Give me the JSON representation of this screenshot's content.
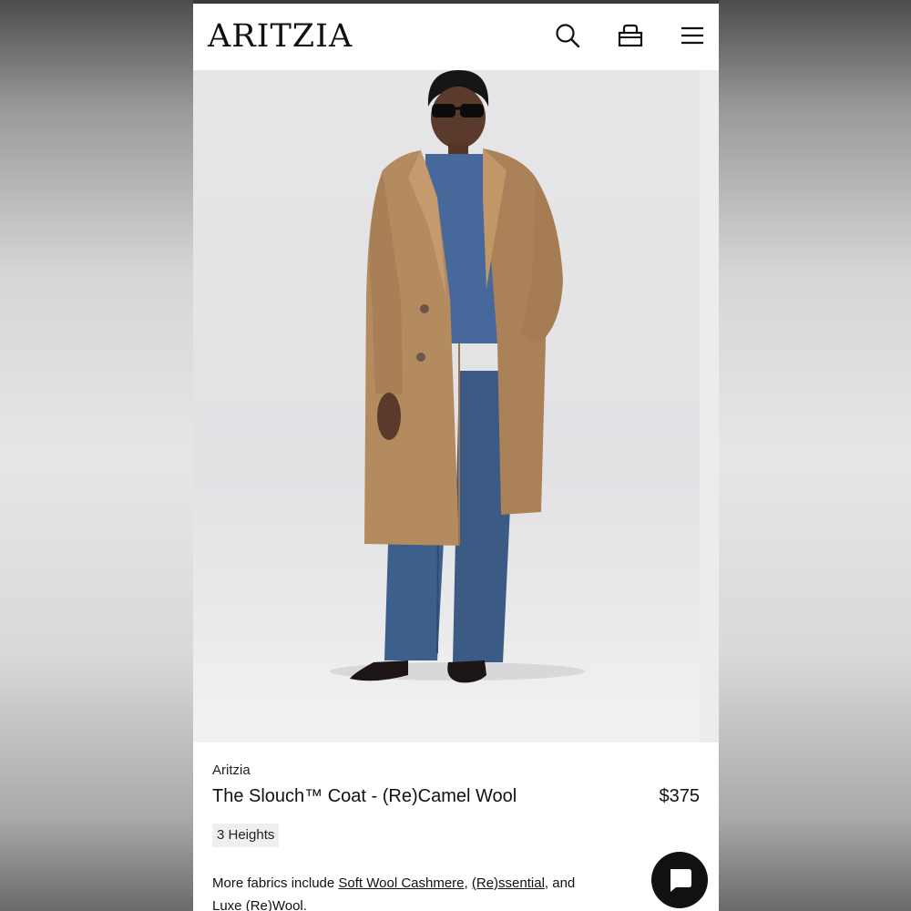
{
  "header": {
    "logo_text": "ARITZIA",
    "icons": [
      "search-icon",
      "bag-icon",
      "menu-icon"
    ]
  },
  "product": {
    "brand": "Aritzia",
    "title": "The Slouch™ Coat - (Re)Camel Wool",
    "price": "$375",
    "badge": "3 Heights",
    "fabrics": {
      "prefix": "More fabrics include ",
      "link1": "Soft Wool Cashmere",
      "sep1": ", ",
      "link2": "(Re)ssential",
      "sep2": ", and",
      "line2": "Luxe (Re)Wool."
    }
  },
  "colors": {
    "coat": "#b48a5f",
    "denim": "#3d5f8c",
    "text": "#111111"
  }
}
